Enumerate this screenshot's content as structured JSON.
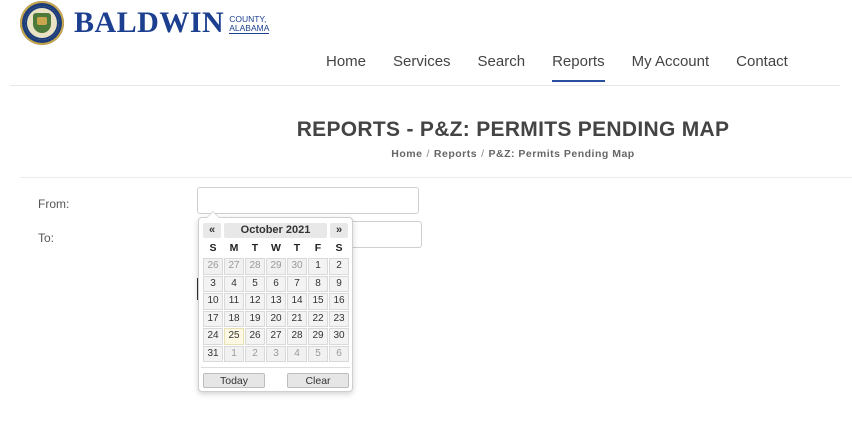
{
  "brand": {
    "name": "BALDWIN",
    "county": "COUNTY,",
    "state": "ALABAMA"
  },
  "nav": {
    "items": [
      {
        "label": "Home"
      },
      {
        "label": "Services"
      },
      {
        "label": "Search"
      },
      {
        "label": "Reports",
        "active": true
      },
      {
        "label": "My Account"
      },
      {
        "label": "Contact"
      }
    ]
  },
  "page": {
    "title": "REPORTS - P&Z: PERMITS PENDING MAP",
    "breadcrumb": [
      "Home",
      "Reports",
      "P&Z: Permits Pending Map"
    ],
    "breadcrumb_sep": "/"
  },
  "form": {
    "from_label": "From:",
    "to_label": "To:",
    "from_value": "",
    "to_value": ""
  },
  "datepicker": {
    "prev": "«",
    "next": "»",
    "month_title": "October 2021",
    "weekdays": [
      "S",
      "M",
      "T",
      "W",
      "T",
      "F",
      "S"
    ],
    "weeks": [
      [
        "26",
        "27",
        "28",
        "29",
        "30",
        "1",
        "2"
      ],
      [
        "3",
        "4",
        "5",
        "6",
        "7",
        "8",
        "9"
      ],
      [
        "10",
        "11",
        "12",
        "13",
        "14",
        "15",
        "16"
      ],
      [
        "17",
        "18",
        "19",
        "20",
        "21",
        "22",
        "23"
      ],
      [
        "24",
        "25",
        "26",
        "27",
        "28",
        "29",
        "30"
      ],
      [
        "31",
        "1",
        "2",
        "3",
        "4",
        "5",
        "6"
      ]
    ],
    "muted_cells": [
      [
        0,
        0
      ],
      [
        0,
        1
      ],
      [
        0,
        2
      ],
      [
        0,
        3
      ],
      [
        0,
        4
      ],
      [
        5,
        1
      ],
      [
        5,
        2
      ],
      [
        5,
        3
      ],
      [
        5,
        4
      ],
      [
        5,
        5
      ],
      [
        5,
        6
      ]
    ],
    "today_cell": [
      4,
      1
    ],
    "today_label": "Today",
    "clear_label": "Clear"
  },
  "colors": {
    "brand": "#1c3f8f",
    "nav_active": "#2a4f9e",
    "today_highlight": "#fcf8e3"
  }
}
